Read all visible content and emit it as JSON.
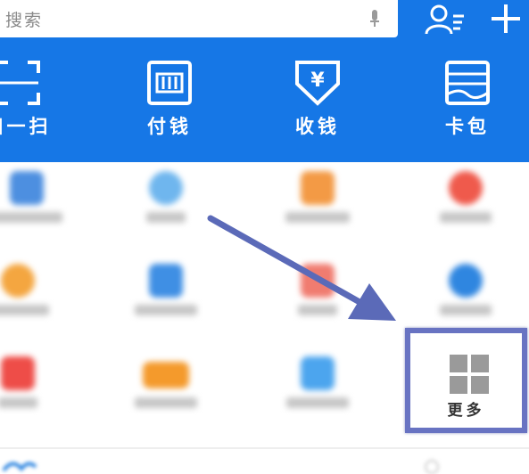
{
  "search": {
    "placeholder": "搜索"
  },
  "quick_actions": [
    {
      "label": "扫一扫",
      "icon": "scan-icon"
    },
    {
      "label": "付钱",
      "icon": "pay-icon"
    },
    {
      "label": "收钱",
      "icon": "receive-money-icon"
    },
    {
      "label": "卡包",
      "icon": "card-wallet-icon"
    }
  ],
  "more_tile": {
    "label": "更多",
    "icon": "grid-icon"
  },
  "colors": {
    "brand_blue": "#1677e6",
    "highlight_border": "#6873c2",
    "arrow": "#5b6ab8"
  }
}
